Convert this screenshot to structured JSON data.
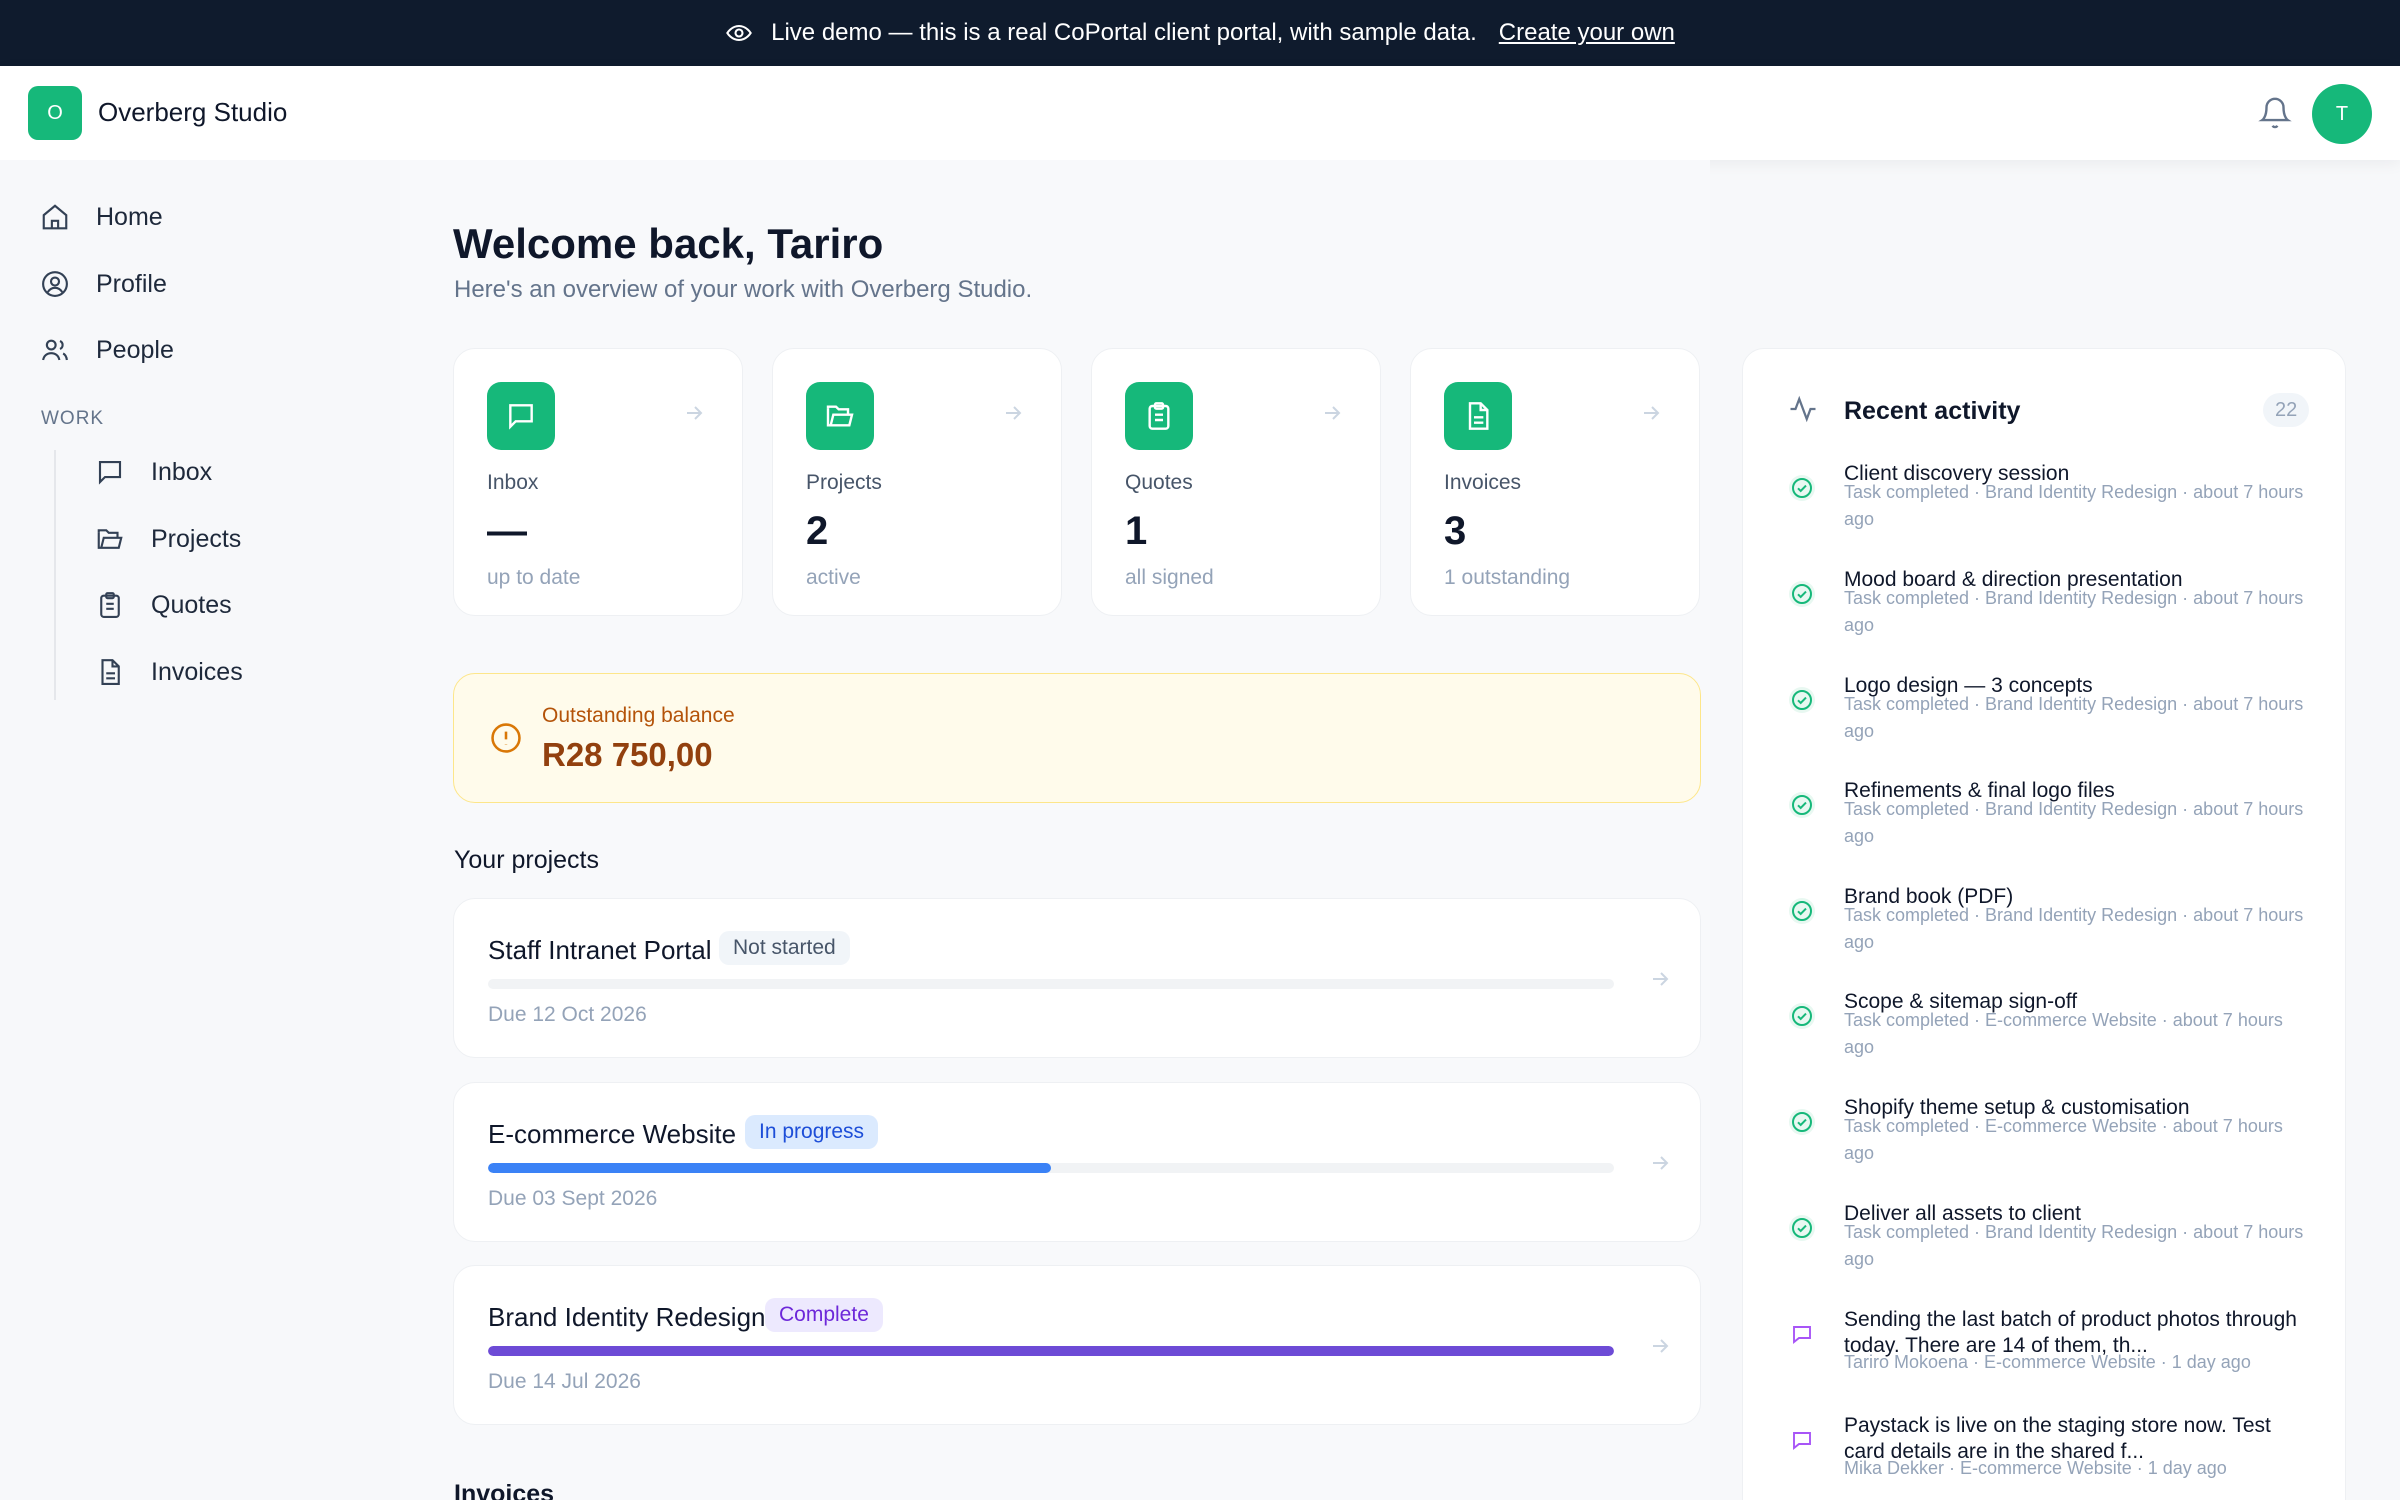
{
  "banner": {
    "text": "Live demo — this is a real CoPortal client portal, with sample data.",
    "link": "Create your own"
  },
  "header": {
    "logo_letter": "O",
    "brand": "Overberg Studio",
    "avatar_letter": "T"
  },
  "sidebar": {
    "items": [
      {
        "label": "Home",
        "icon": "home-icon"
      },
      {
        "label": "Profile",
        "icon": "user-circle-icon"
      },
      {
        "label": "People",
        "icon": "users-icon"
      }
    ],
    "section_label": "WORK",
    "work_items": [
      {
        "label": "Inbox",
        "icon": "message-icon"
      },
      {
        "label": "Projects",
        "icon": "folder-icon"
      },
      {
        "label": "Quotes",
        "icon": "clipboard-icon"
      },
      {
        "label": "Invoices",
        "icon": "file-icon"
      }
    ]
  },
  "main": {
    "welcome": "Welcome back, Tariro",
    "subtitle": "Here's an overview of your work with Overberg Studio.",
    "stats": [
      {
        "label": "Inbox",
        "value": "—",
        "sub": "up to date"
      },
      {
        "label": "Projects",
        "value": "2",
        "sub": "active"
      },
      {
        "label": "Quotes",
        "value": "1",
        "sub": "all signed"
      },
      {
        "label": "Invoices",
        "value": "3",
        "sub": "1 outstanding"
      }
    ],
    "balance": {
      "label": "Outstanding balance",
      "value": "R28 750,00"
    },
    "projects_title": "Your projects",
    "projects": [
      {
        "name": "Staff Intranet Portal",
        "status": "Not started",
        "due": "Due 12 Oct 2026",
        "progress": 0,
        "color": "#e5e7eb"
      },
      {
        "name": "E-commerce Website",
        "status": "In progress",
        "due": "Due 03 Sept 2026",
        "progress": 0.5,
        "color": "#3b82f6"
      },
      {
        "name": "Brand Identity Redesign",
        "status": "Complete",
        "due": "Due 14 Jul 2026",
        "progress": 1,
        "color": "#6d4bd6"
      }
    ],
    "invoices_title": "Invoices"
  },
  "activity": {
    "title": "Recent activity",
    "count": "22",
    "items": [
      {
        "title": "Client discovery session",
        "meta": "Task completed · Brand Identity Redesign · about 7 hours ago",
        "type": "done"
      },
      {
        "title": "Mood board & direction presentation",
        "meta": "Task completed · Brand Identity Redesign · about 7 hours ago",
        "type": "done"
      },
      {
        "title": "Logo design — 3 concepts",
        "meta": "Task completed · Brand Identity Redesign · about 7 hours ago",
        "type": "done"
      },
      {
        "title": "Refinements & final logo files",
        "meta": "Task completed · Brand Identity Redesign · about 7 hours ago",
        "type": "done"
      },
      {
        "title": "Brand book (PDF)",
        "meta": "Task completed · Brand Identity Redesign · about 7 hours ago",
        "type": "done"
      },
      {
        "title": "Scope & sitemap sign-off",
        "meta": "Task completed · E-commerce Website · about 7 hours ago",
        "type": "done"
      },
      {
        "title": "Shopify theme setup & customisation",
        "meta": "Task completed · E-commerce Website · about 7 hours ago",
        "type": "done"
      },
      {
        "title": "Deliver all assets to client",
        "meta": "Task completed · Brand Identity Redesign · about 7 hours ago",
        "type": "done"
      },
      {
        "title": "Sending the last batch of product photos through today. There are 14 of them, th...",
        "meta": "Tariro Mokoena · E-commerce Website · 1 day ago",
        "type": "message"
      },
      {
        "title": "Paystack is live on the staging store now. Test card details are in the shared f...",
        "meta": "Mika Dekker · E-commerce Website · 1 day ago",
        "type": "message"
      }
    ]
  }
}
